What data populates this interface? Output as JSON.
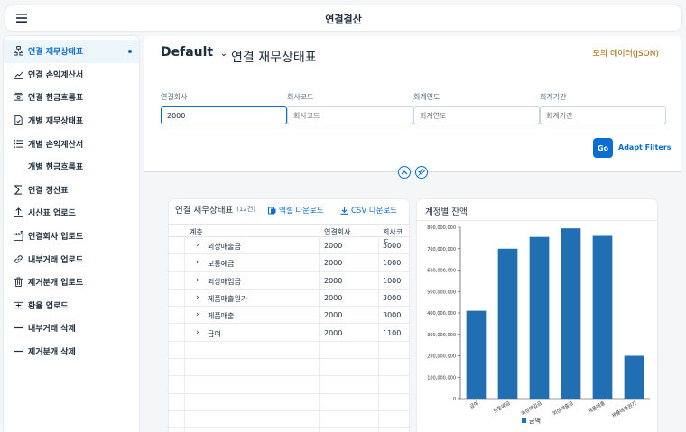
{
  "shell": {
    "title": "연결결산"
  },
  "sidebar": {
    "items": [
      {
        "label": "연결 재무상태표",
        "icon": "hierarchy-icon",
        "active": true
      },
      {
        "label": "연결 손익계산서",
        "icon": "line-chart-icon"
      },
      {
        "label": "연결 현금흐름표",
        "icon": "money-bills-icon"
      },
      {
        "label": "개별 재무상태표",
        "icon": "document-icon"
      },
      {
        "label": "개별 손익계산서",
        "icon": "list-icon"
      },
      {
        "label": "개별 현금흐름표",
        "icon": ""
      },
      {
        "label": "연결 정산표",
        "icon": "sum-icon"
      },
      {
        "label": "시산표 업로드",
        "icon": "upload-icon"
      },
      {
        "label": "연결회사 업로드",
        "icon": "factory-icon"
      },
      {
        "label": "내부거래 업로드",
        "icon": "link-icon"
      },
      {
        "label": "제거분개 업로드",
        "icon": "delete-icon"
      },
      {
        "label": "환율 업로드",
        "icon": "currency-icon"
      },
      {
        "label": "내부거래 삭제",
        "icon": "minus-icon"
      },
      {
        "label": "제거분개 삭제",
        "icon": "minus-icon"
      }
    ]
  },
  "header": {
    "variant": "Default",
    "title": "연결 재무상태표",
    "mock_link": "모의 데이터(JSON)"
  },
  "filters": [
    {
      "label": "연결회사",
      "value": "2000",
      "placeholder": ""
    },
    {
      "label": "회사코드",
      "value": "",
      "placeholder": "회사코드"
    },
    {
      "label": "회계연도",
      "value": "",
      "placeholder": "회계연도"
    },
    {
      "label": "회계기간",
      "value": "",
      "placeholder": "회계기간"
    }
  ],
  "filterbar": {
    "go_label": "Go",
    "adapt_label": "Adapt Filters"
  },
  "table": {
    "title": "연결 재무상태표",
    "count": "(12건)",
    "excel_label": "엑셀 다운로드",
    "csv_label": "CSV 다운로드",
    "columns": [
      "계층",
      "연결회사",
      "회사코드"
    ],
    "rows": [
      {
        "name": "외상매출금",
        "group": "2000",
        "company": "3000"
      },
      {
        "name": "보통예금",
        "group": "2000",
        "company": "1000"
      },
      {
        "name": "외상매입금",
        "group": "2000",
        "company": "1000"
      },
      {
        "name": "제품매출원가",
        "group": "2000",
        "company": "3000"
      },
      {
        "name": "제품매출",
        "group": "2000",
        "company": "3000"
      },
      {
        "name": "급여",
        "group": "2000",
        "company": "1100"
      }
    ]
  },
  "chart": {
    "title": "계정별 잔액"
  },
  "chart_data": {
    "type": "bar",
    "categories": [
      "급여",
      "보통예금",
      "외상매입금",
      "외상매출금",
      "제품매출",
      "제품매출원가"
    ],
    "series": [
      {
        "name": "금액",
        "values": [
          410000000,
          700000000,
          755000000,
          795000000,
          760000000,
          200000000
        ]
      }
    ],
    "ylim": [
      0,
      800000000
    ],
    "yticks": [
      "0",
      "100,000,000",
      "200,000,000",
      "300,000,000",
      "400,000,000",
      "500,000,000",
      "600,000,000",
      "700,000,000",
      "800,000,000"
    ],
    "legend": "bottom",
    "color": "#1f6fb2"
  }
}
